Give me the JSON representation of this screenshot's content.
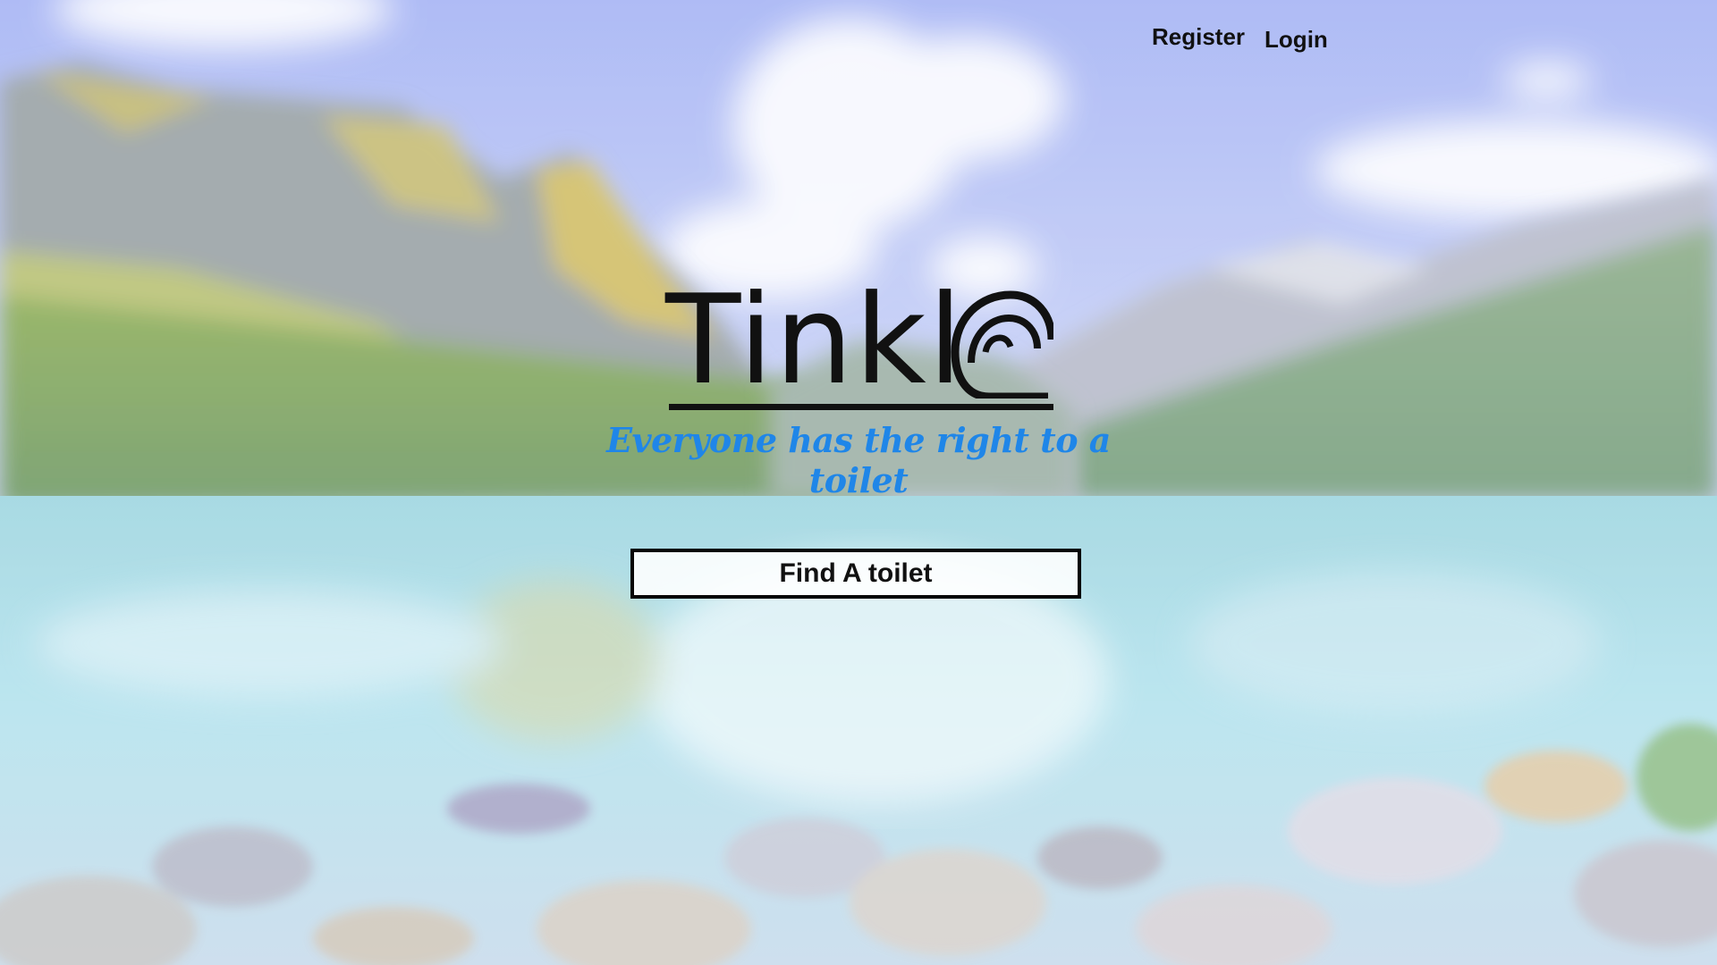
{
  "nav": {
    "register_label": "Register",
    "login_label": "Login"
  },
  "hero": {
    "logo_text": "Tinkl",
    "tagline": "Everyone has the right to a toilet",
    "find_button_label": "Find A toilet"
  },
  "colors": {
    "tagline": "#1f86e8",
    "text": "#111111"
  }
}
